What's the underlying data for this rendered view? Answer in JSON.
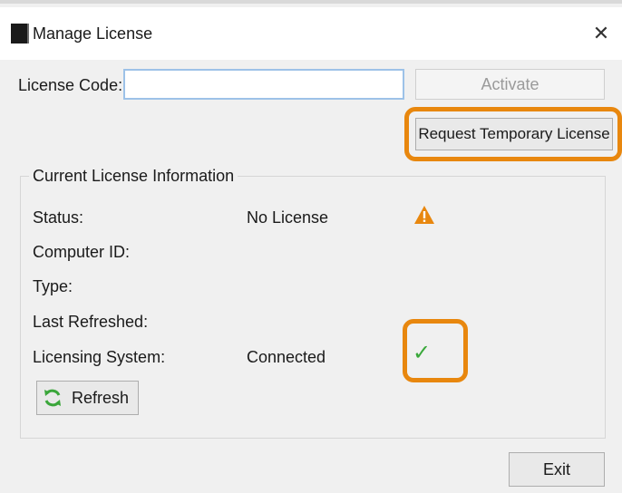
{
  "window": {
    "title": "Manage License",
    "close_glyph": "✕"
  },
  "license": {
    "label": "License Code:",
    "value": "",
    "placeholder": "",
    "activate_label": "Activate",
    "request_temp_label": "Request Temporary License"
  },
  "current_info": {
    "group_title": "Current License Information",
    "rows": [
      {
        "label": "Status:",
        "value": "No License",
        "icon": "warning-icon"
      },
      {
        "label": "Computer ID:",
        "value": ""
      },
      {
        "label": "Type:",
        "value": ""
      },
      {
        "label": "Last Refreshed:",
        "value": ""
      },
      {
        "label": "Licensing System:",
        "value": "Connected",
        "icon": "check-icon"
      }
    ],
    "refresh_label": "Refresh"
  },
  "footer": {
    "exit_label": "Exit"
  },
  "colors": {
    "highlight": "#e8870e",
    "warning": "#e8870e",
    "success": "#39a83a",
    "refresh_icon": "#3aa63a"
  }
}
